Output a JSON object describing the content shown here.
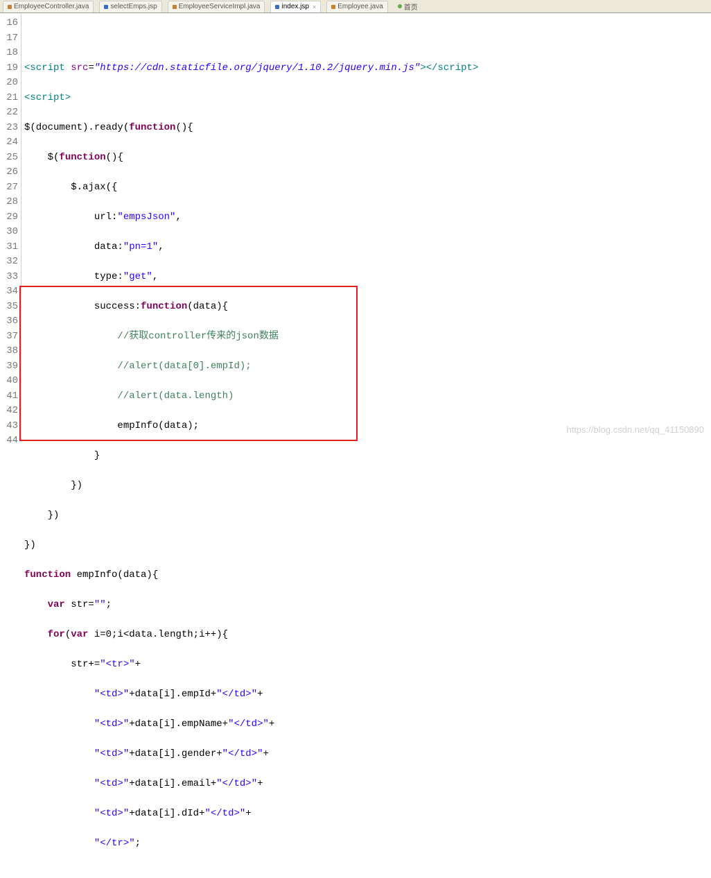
{
  "tabs": [
    {
      "label": "EmployeeController.java",
      "active": false
    },
    {
      "label": "selectEmps.jsp",
      "active": false
    },
    {
      "label": "EmployeeServiceImpl.java",
      "active": false
    },
    {
      "label": "index.jsp",
      "active": true
    },
    {
      "label": "Employee.java",
      "active": false
    },
    {
      "label": "首页",
      "active": false
    }
  ],
  "startLine": 16,
  "endLine": 44,
  "code": {
    "scriptSrc": "https://cdn.staticfile.org/jquery/1.10.2/jquery.min.js",
    "ajax": {
      "url_label": "url:",
      "url_val": "\"empsJson\"",
      "data_label": "data:",
      "data_val": "\"pn=1\"",
      "type_label": "type:",
      "type_val": "\"get\"",
      "success_label": "success:"
    },
    "comment_cn": "//获取controller传来的json数据",
    "comment_alert1": "//alert(data[0].empId);",
    "comment_alert2": "//alert(data.length)",
    "empInfoCall": "empInfo(data);",
    "fn_head": "function",
    "fn_name": " empInfo(data){",
    "var_str": "var",
    "str_eq": " str=",
    "empty_str": "\"\"",
    "for_kw": "for",
    "for_rest": "(",
    "for_var": "var",
    "for_tail": " i=0;i<data.length;i++){",
    "concat_tr": "\"<tr>\"",
    "concat_td_open": "\"<td>\"",
    "concat_td_close": "\"</td>\"",
    "concat_trclose": "\"</tr>\"",
    "fields": [
      "empId",
      "empName",
      "gender",
      "email",
      "dId"
    ]
  },
  "watermark": "https://blog.csdn.net/qq_41150890"
}
